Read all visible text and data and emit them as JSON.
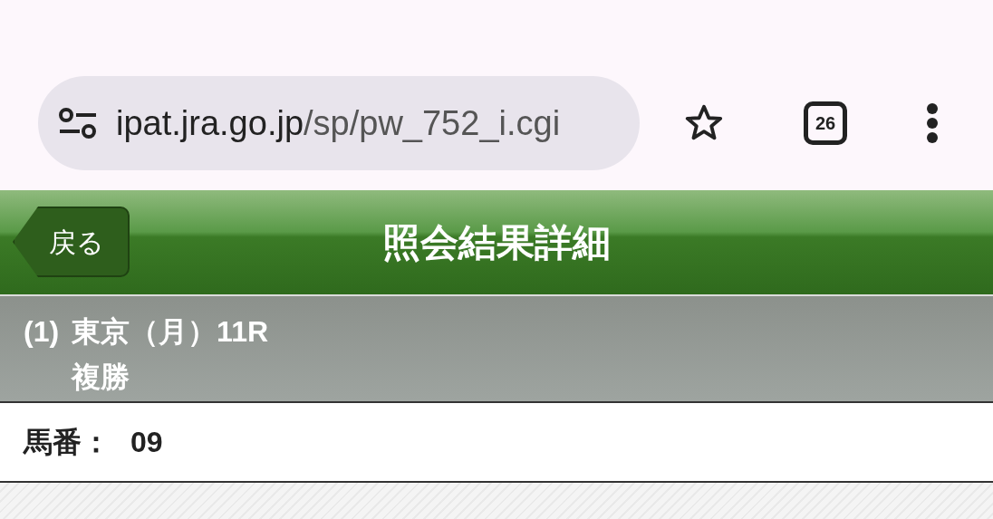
{
  "browser": {
    "url_host": "ipat.jra.go.jp",
    "url_path": "/sp/pw_752_i.cgi",
    "tab_count": "26"
  },
  "header": {
    "back_button": "戻る",
    "title": "照会結果詳細"
  },
  "race": {
    "number": "(1)",
    "name": "東京（月）11R",
    "bet_type": "複勝"
  },
  "detail": {
    "label": "馬番：",
    "value": "09"
  }
}
